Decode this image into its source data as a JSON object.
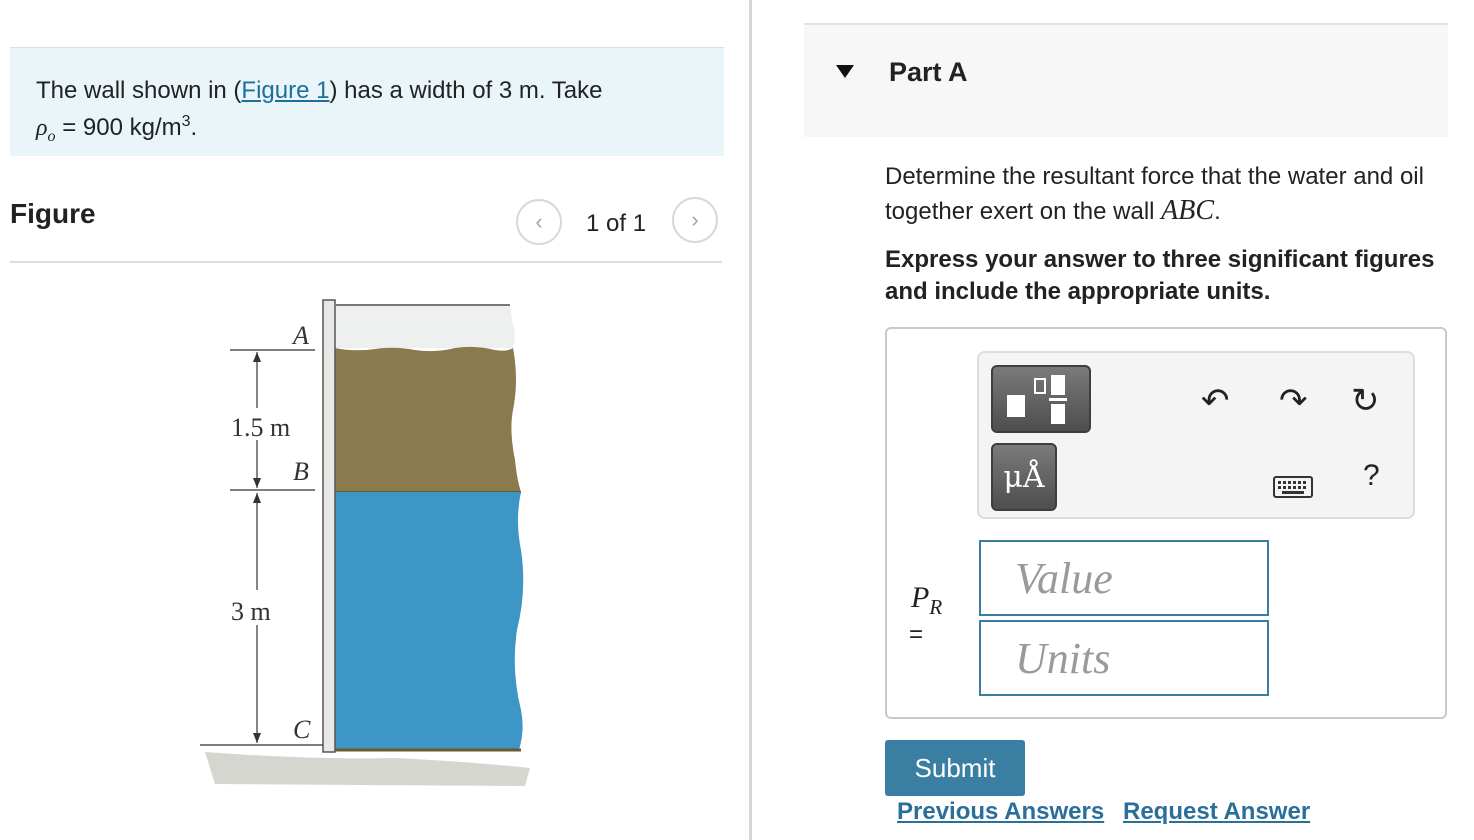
{
  "problem": {
    "prefix": "The wall shown in (",
    "figure_link": "Figure 1",
    "suffix": ") has a width of 3 m. Take",
    "rho_symbol": "ρ",
    "rho_sub": "o",
    "rho_value": " = 900 kg/m",
    "rho_exp": "3",
    "rho_end": "."
  },
  "figure": {
    "title": "Figure",
    "counter": "1 of 1",
    "labels": {
      "a": "A",
      "b": "B",
      "c": "C",
      "dim_top": "1.5 m",
      "dim_bottom": "3 m"
    },
    "colors": {
      "oil": "#8a7a4e",
      "water": "#3d96c6",
      "wall": "#e8e8e6",
      "ground": "#d6d6d0"
    }
  },
  "part": {
    "title": "Part A",
    "question_prefix": "Determine the resultant force that the water and oil together exert on the wall ",
    "question_var": "ABC",
    "question_end": ".",
    "instruction": "Express your answer to three significant figures and include the appropriate units."
  },
  "answer": {
    "var_main": "P",
    "var_sub": "R",
    "equals": "=",
    "value_placeholder": "Value",
    "units_placeholder": "Units",
    "units_symbol": "μÅ",
    "help": "?"
  },
  "actions": {
    "submit": "Submit",
    "previous_answers": "Previous Answers",
    "request_answer": "Request Answer"
  },
  "colors": {
    "accent": "#3a7fa2",
    "link": "#2a6f9a",
    "problem_bg": "#e9f5f9"
  }
}
